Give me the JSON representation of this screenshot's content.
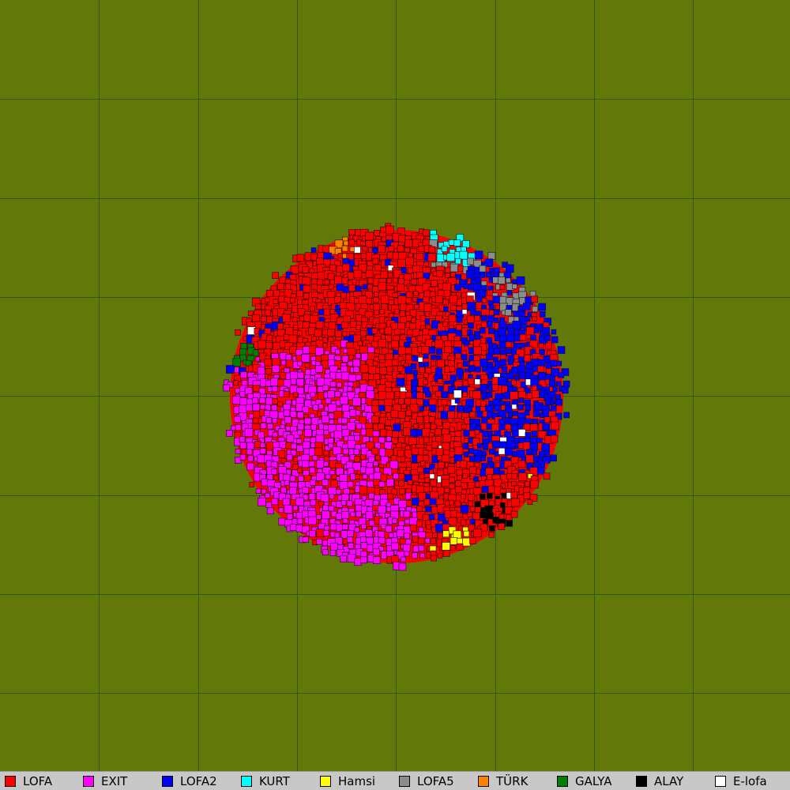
{
  "map": {
    "background_color": "#627808",
    "grid_color": "#2f5a14",
    "border_color": "#111111"
  },
  "legend": {
    "items": [
      {
        "name": "LOFA",
        "color": "#ff0000"
      },
      {
        "name": "EXIT",
        "color": "#ff00ff"
      },
      {
        "name": "LOFA2",
        "color": "#0000ff"
      },
      {
        "name": "KURT",
        "color": "#00ffff"
      },
      {
        "name": "Hamsi",
        "color": "#ffff00"
      },
      {
        "name": "LOFA5",
        "color": "#8c8c8c"
      },
      {
        "name": "TÜRK",
        "color": "#ff8000"
      },
      {
        "name": "GALYA",
        "color": "#008000"
      },
      {
        "name": "ALAY",
        "color": "#000000"
      },
      {
        "name": "E-lofa",
        "color": "#ffffff"
      }
    ]
  }
}
